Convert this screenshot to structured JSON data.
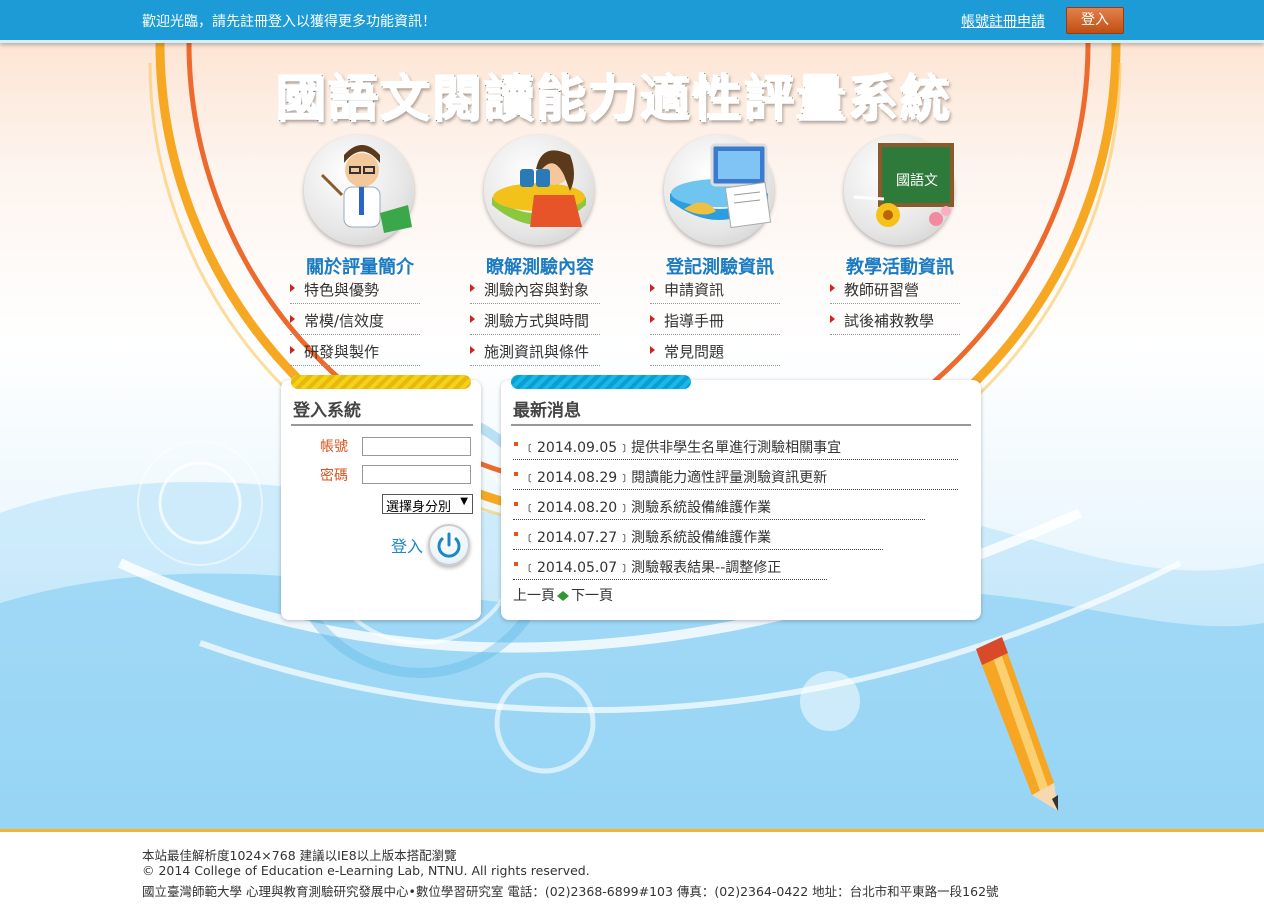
{
  "topbar": {
    "welcome": "歡迎光臨，請先註冊登入以獲得更多功能資訊！",
    "register_link": "帳號註冊申請",
    "login_button": "登入"
  },
  "header": {
    "title": "國語文閱讀能力適性評量系統"
  },
  "categories": [
    {
      "title": "關於評量簡介",
      "icon": "teacher-pointer-icon",
      "items": [
        "特色與優勢",
        "常模/信效度",
        "研發與製作"
      ]
    },
    {
      "title": "瞭解測驗內容",
      "icon": "binoculars-girl-icon",
      "items": [
        "測驗內容與對象",
        "測驗方式與時間",
        "施測資訊與條件"
      ]
    },
    {
      "title": "登記測驗資訊",
      "icon": "computer-documents-icon",
      "items": [
        "申請資訊",
        "指導手冊",
        "常見問題"
      ]
    },
    {
      "title": "教學活動資訊",
      "icon": "chalkboard-icon",
      "items": [
        "教師研習營",
        "試後補救教學"
      ]
    }
  ],
  "chalkboard_text": "國語文",
  "login": {
    "title": "登入系統",
    "account_label": "帳號",
    "password_label": "密碼",
    "role_select": "選擇身分別",
    "login_label": "登入"
  },
  "news": {
    "title": "最新消息",
    "items": [
      "﹝2014.09.05﹞提供非學生名單進行測驗相關事宜",
      "﹝2014.08.29﹞閱讀能力適性評量測驗資訊更新",
      "﹝2014.08.20﹞測驗系統設備維護作業",
      "﹝2014.07.27﹞測驗系統設備維護作業",
      "﹝2014.05.07﹞測驗報表結果--調整修正"
    ],
    "prev": "上一頁",
    "next": "下一頁"
  },
  "footer": {
    "line1": "本站最佳解析度1024×768 建議以IE8以上版本搭配瀏覽",
    "line2": "© 2014 College of Education e-Learning Lab, NTNU. All rights reserved.",
    "line3": "國立臺灣師範大學 心理與教育測驗研究發展中心•數位學習研究室 電話：(02)2368-6899#103 傳真：(02)2364-0422 地址：台北市和平東路一段162號"
  },
  "colors": {
    "topbar": "#1c9bd6",
    "accent_orange": "#f7a823",
    "link_blue": "#1b7cc4",
    "footer_border": "#f7b52a"
  }
}
